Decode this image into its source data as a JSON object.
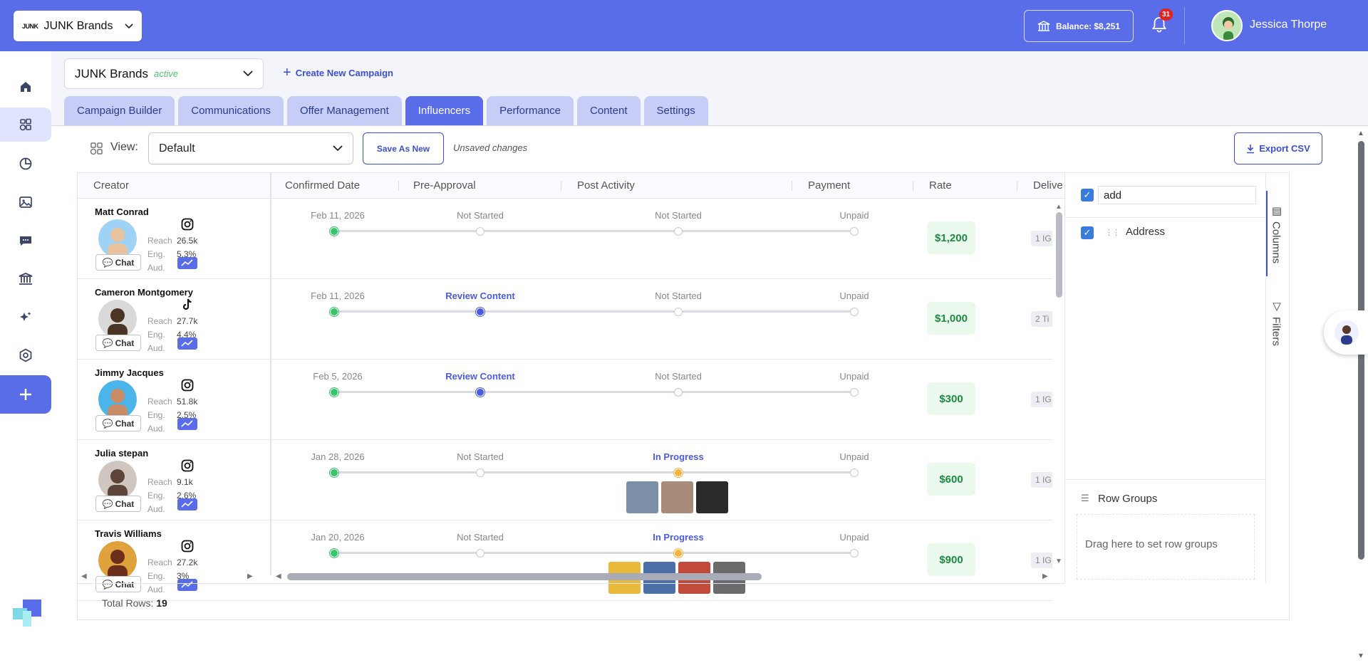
{
  "topbar": {
    "brand_logo": "JUNK",
    "brand_name": "JUNK Brands",
    "balance_label": "Balance: $8,251",
    "notification_count": "31",
    "user_name": "Jessica Thorpe"
  },
  "campaign": {
    "name": "JUNK Brands",
    "status": "active",
    "create_label": "Create New Campaign"
  },
  "tabs": [
    "Campaign Builder",
    "Communications",
    "Offer Management",
    "Influencers",
    "Performance",
    "Content",
    "Settings"
  ],
  "active_tab": "Influencers",
  "toolbar": {
    "view_label": "View:",
    "view_value": "Default",
    "save_as_new": "Save As New",
    "unsaved": "Unsaved changes",
    "export": "Export CSV"
  },
  "grid": {
    "headers": [
      "Creator",
      "Confirmed Date",
      "Pre-Approval",
      "Post Activity",
      "Payment",
      "Rate",
      "Delive"
    ],
    "stat_labels": [
      "Reach",
      "Eng.",
      "Aud."
    ],
    "chat_label": "Chat",
    "rows": [
      {
        "name": "Matt Conrad",
        "platform": "instagram",
        "reach": "26.5k",
        "eng": "5.3%",
        "confirmed": "Feb 11, 2026",
        "pre_approval": "Not Started",
        "post_activity": "Not Started",
        "payment": "Unpaid",
        "rate": "$1,200",
        "deliverable": "1 IG",
        "stage": 0
      },
      {
        "name": "Cameron Montgomery",
        "platform": "tiktok",
        "reach": "27.7k",
        "eng": "4.4%",
        "confirmed": "Feb 11, 2026",
        "pre_approval": "Review Content",
        "post_activity": "Not Started",
        "payment": "Unpaid",
        "rate": "$1,000",
        "deliverable": "2 Ti",
        "stage": 1
      },
      {
        "name": "Jimmy Jacques",
        "platform": "instagram",
        "reach": "51.8k",
        "eng": "2.5%",
        "confirmed": "Feb 5, 2026",
        "pre_approval": "Review Content",
        "post_activity": "Not Started",
        "payment": "Unpaid",
        "rate": "$300",
        "deliverable": "1 IG",
        "stage": 1
      },
      {
        "name": "Julia stepan",
        "platform": "instagram",
        "reach": "9.1k",
        "eng": "2.6%",
        "confirmed": "Jan 28, 2026",
        "pre_approval": "Not Started",
        "post_activity": "In Progress",
        "payment": "Unpaid",
        "rate": "$600",
        "deliverable": "1 IG",
        "stage": 2
      },
      {
        "name": "Travis Williams",
        "platform": "instagram",
        "reach": "27.2k",
        "eng": "3%",
        "confirmed": "Jan 20, 2026",
        "pre_approval": "Not Started",
        "post_activity": "In Progress",
        "payment": "Unpaid",
        "rate": "$900",
        "deliverable": "1 IG",
        "stage": 2
      }
    ],
    "total_rows_label": "Total Rows:",
    "total_rows": "19"
  },
  "panel": {
    "search_value": "add",
    "column_item": "Address",
    "row_groups_title": "Row Groups",
    "row_groups_hint": "Drag here to set row groups",
    "tab_columns": "Columns",
    "tab_filters": "Filters"
  },
  "colors": {
    "primary": "#5a6de8",
    "accent_text": "#3b4fd1",
    "success": "#38c56a",
    "rate_bg": "#eaf8ee",
    "in_progress": "#f5b33d"
  }
}
